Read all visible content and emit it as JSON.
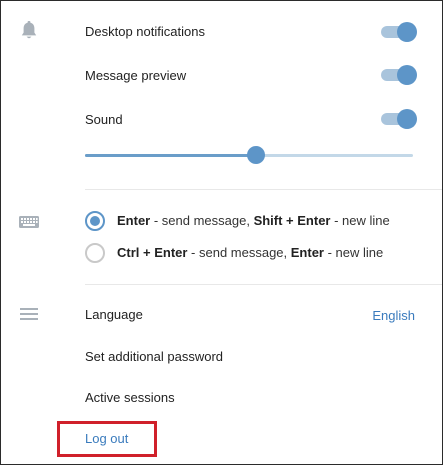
{
  "notifications": {
    "icon": "bell-icon",
    "desktop_label": "Desktop notifications",
    "desktop_on": true,
    "preview_label": "Message preview",
    "preview_on": true,
    "sound_label": "Sound",
    "sound_on": true,
    "volume_fraction": 0.52
  },
  "input": {
    "icon": "keyboard-icon",
    "options": [
      {
        "key1": "Enter",
        "t1": " - send message, ",
        "key2": "Shift + Enter",
        "t2": " - new line",
        "selected": true
      },
      {
        "key1": "Ctrl + Enter",
        "t1": " - send message, ",
        "key2": "Enter",
        "t2": " - new line",
        "selected": false
      }
    ]
  },
  "general": {
    "icon": "menu-icon",
    "language_label": "Language",
    "language_value": "English",
    "password_label": "Set additional password",
    "sessions_label": "Active sessions",
    "logout_label": "Log out"
  },
  "colors": {
    "accent": "#5d95c8",
    "link": "#3a7bbd",
    "highlight_box": "#d0202a"
  }
}
